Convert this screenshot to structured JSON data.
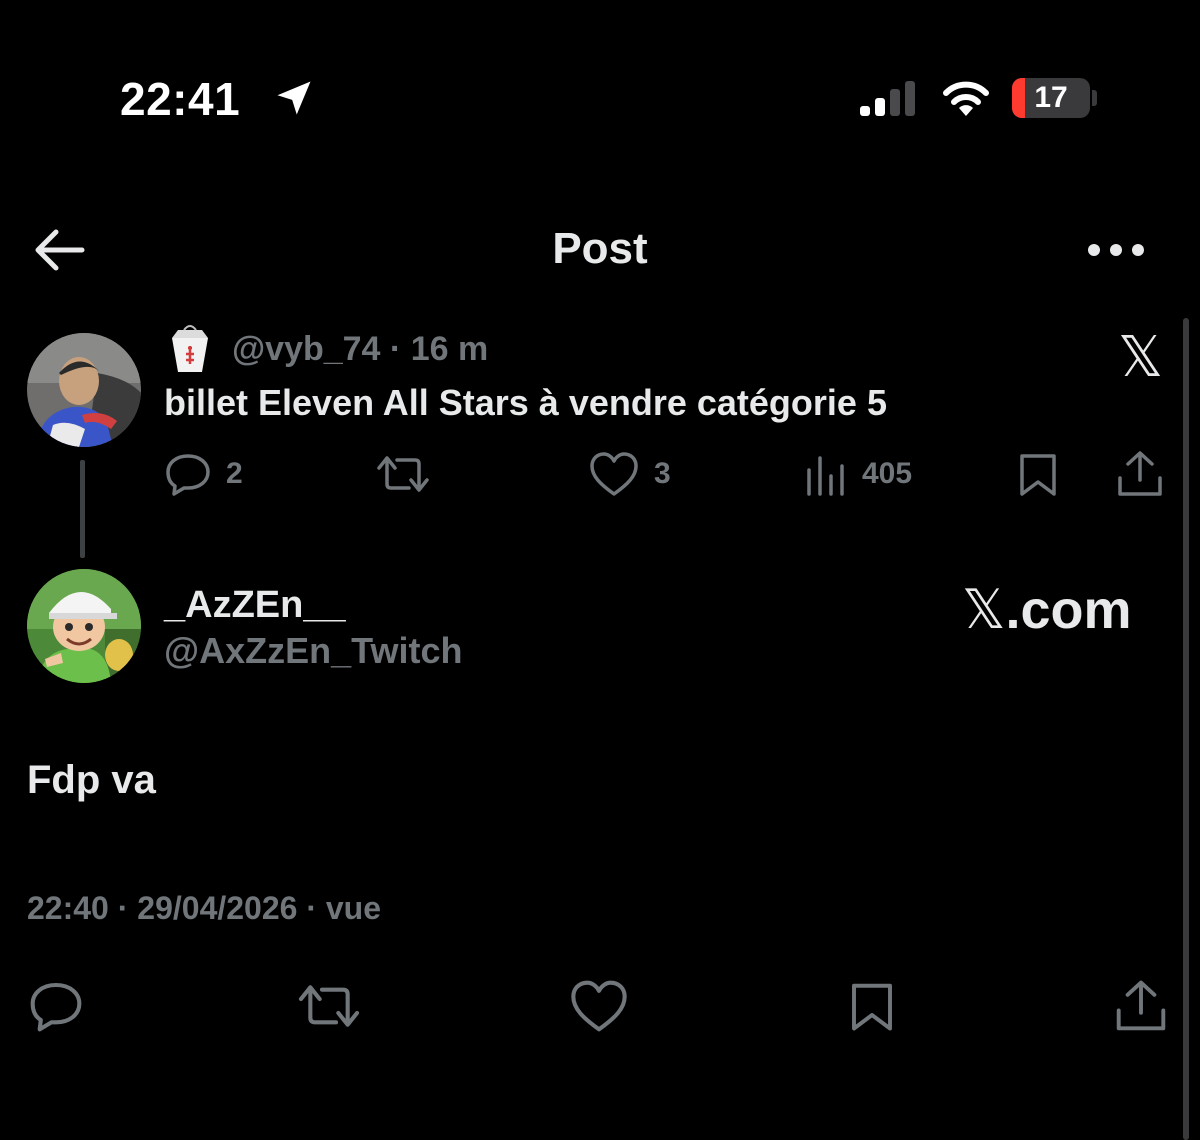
{
  "status_bar": {
    "time": "22:41",
    "battery_level": "17",
    "battery_fraction": 0.17,
    "battery_color": "#ff3b30"
  },
  "header": {
    "title": "Post",
    "back_icon": "arrow-left-icon",
    "more_icon": "more-horizontal-icon"
  },
  "parent_post": {
    "emoji_icon": "takeout-box-icon",
    "handle": "@vyb_74",
    "separator": "·",
    "age": "16 m",
    "brand_icon": "x-logo-icon",
    "text": "billet Eleven All Stars à vendre catégorie 5",
    "actions": {
      "reply_count": "2",
      "repost_count": "",
      "like_count": "3",
      "view_count": "405"
    }
  },
  "reply_post": {
    "display_name": "_AzZEn__",
    "username": "@AxZzEn_Twitch",
    "watermark_suffix": ".com",
    "text": "Fdp va",
    "time": "22:40",
    "date": "29/04/2026",
    "views_label": "vue"
  },
  "colors": {
    "background": "#000000",
    "primary_text": "#e7e9ea",
    "secondary_text": "#71767b",
    "battery_low": "#ff3b30"
  }
}
